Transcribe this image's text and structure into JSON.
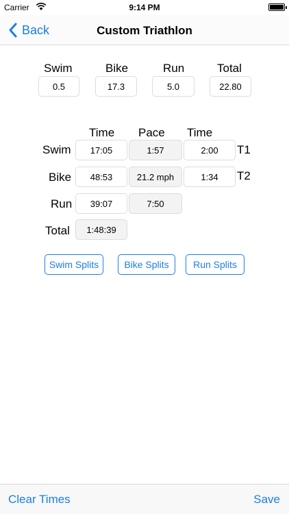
{
  "status": {
    "carrier": "Carrier",
    "time": "9:14 PM"
  },
  "nav": {
    "back_label": "Back",
    "title": "Custom Triathlon"
  },
  "distances": {
    "headers": [
      "Swim",
      "Bike",
      "Run",
      "Total"
    ],
    "values": [
      "0.5",
      "17.3",
      "5.0",
      "22.80"
    ]
  },
  "times": {
    "col_headers": [
      "Time",
      "Pace",
      "Time"
    ],
    "rows": [
      {
        "label": "Swim",
        "time": "17:05",
        "pace": "1:57",
        "transition": "2:00",
        "transition_label": "T1"
      },
      {
        "label": "Bike",
        "time": "48:53",
        "pace": "21.2 mph",
        "transition": "1:34",
        "transition_label": "T2"
      },
      {
        "label": "Run",
        "time": "39:07",
        "pace": "7:50"
      }
    ],
    "total_label": "Total",
    "total_time": "1:48:39"
  },
  "splits": {
    "swim": "Swim Splits",
    "bike": "Bike Splits",
    "run": "Run Splits"
  },
  "toolbar": {
    "clear": "Clear Times",
    "save": "Save"
  },
  "colors": {
    "accent": "#1a7ee6"
  }
}
